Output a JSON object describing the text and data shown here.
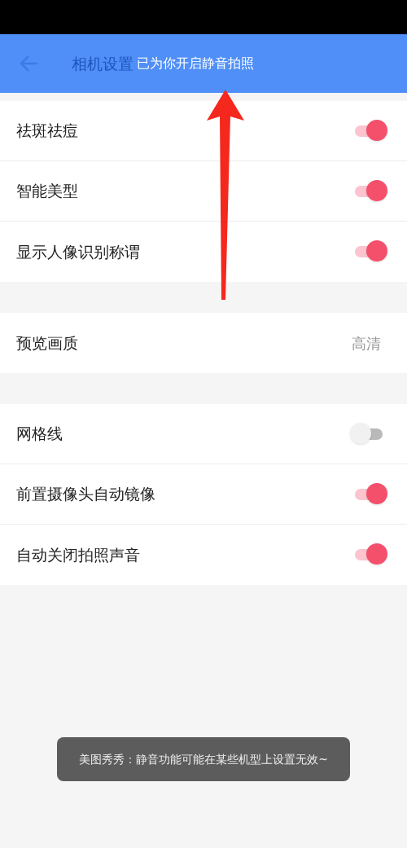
{
  "header": {
    "title": "相机设置",
    "notice": "已为你开启静音拍照"
  },
  "sections": [
    {
      "items": [
        {
          "kind": "toggle",
          "label": "祛斑祛痘",
          "on": true
        },
        {
          "kind": "toggle",
          "label": "智能美型",
          "on": true
        },
        {
          "kind": "toggle",
          "label": "显示人像识别称谓",
          "on": true
        }
      ]
    },
    {
      "items": [
        {
          "kind": "value",
          "label": "预览画质",
          "value": "高清"
        }
      ]
    },
    {
      "items": [
        {
          "kind": "toggle",
          "label": "网格线",
          "on": false
        },
        {
          "kind": "toggle",
          "label": "前置摄像头自动镜像",
          "on": true
        },
        {
          "kind": "toggle",
          "label": "自动关闭拍照声音",
          "on": true
        }
      ]
    }
  ],
  "toast": "美图秀秀：静音功能可能在某些机型上设置无效~"
}
